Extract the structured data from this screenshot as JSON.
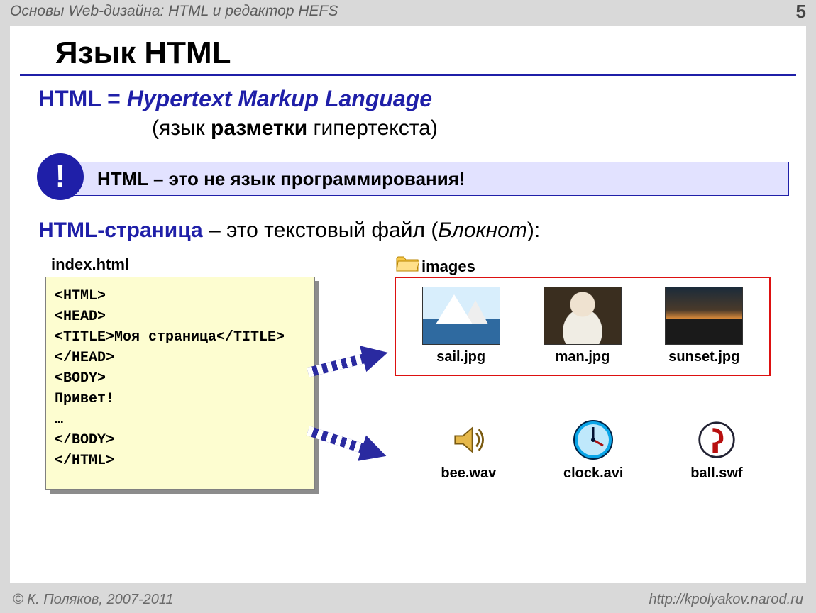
{
  "header": {
    "breadcrumb": "Основы Web-дизайна: HTML и редактор HEFS",
    "page_number": "5"
  },
  "slide": {
    "title": "Язык HTML",
    "definition": {
      "term": "HTML",
      "equals": " = ",
      "expansion": "Hypertext Markup Language",
      "sub_prefix": "(язык ",
      "sub_bold": "разметки",
      "sub_suffix": " гипертекста)"
    },
    "callout": {
      "mark": "!",
      "text": "HTML – это не язык программирования!"
    },
    "page_line": {
      "term": "HTML-страница",
      "rest_a": " – это текстовый файл (",
      "rest_ital": "Блокнот",
      "rest_b": "):"
    },
    "code": {
      "filename": "index.html",
      "source": "<HTML>\n<HEAD>\n<TITLE>Моя страница</TITLE>\n</HEAD>\n<BODY>\nПривет!\n…\n</BODY>\n</HTML>"
    },
    "images_folder": {
      "label": "images",
      "items": [
        {
          "file": "sail.jpg"
        },
        {
          "file": "man.jpg"
        },
        {
          "file": "sunset.jpg"
        }
      ]
    },
    "media": [
      {
        "file": "bee.wav",
        "icon": "speaker-icon"
      },
      {
        "file": "clock.avi",
        "icon": "clock-icon"
      },
      {
        "file": "ball.swf",
        "icon": "flash-icon"
      }
    ]
  },
  "footer": {
    "copyright": "© К. Поляков, 2007-2011",
    "url": "http://kpolyakov.narod.ru"
  }
}
